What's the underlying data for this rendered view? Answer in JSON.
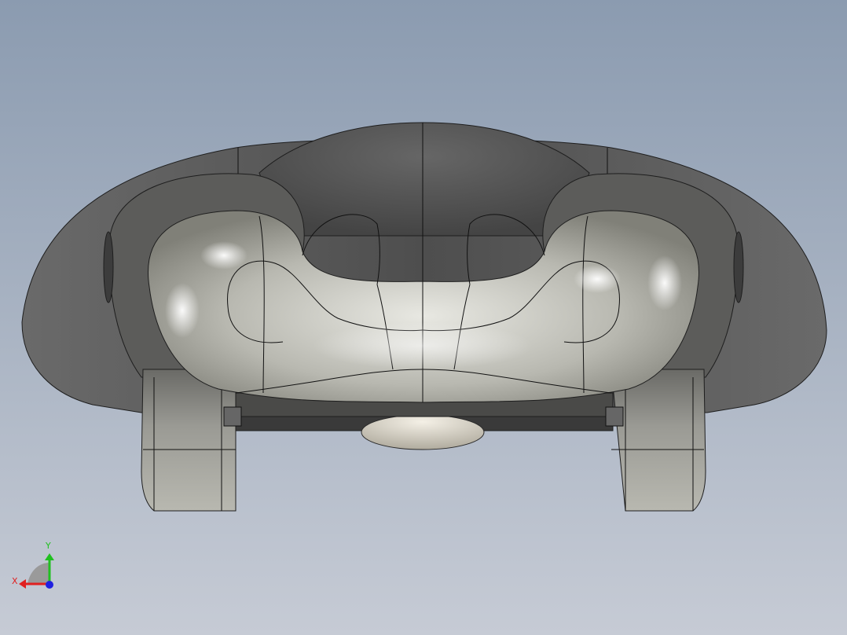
{
  "viewport": {
    "background_top": "#8b9bb0",
    "background_bottom": "#c6cbd5"
  },
  "model": {
    "shell_color": "#5a5a5a",
    "shell_edge_color": "#1a1a1a",
    "seat_color": "#c8c8c2",
    "seat_highlight": "#f7f7f1"
  },
  "triad": {
    "x_label": "X",
    "y_label": "Y",
    "x_color": "#e02020",
    "y_color": "#20c020",
    "z_color": "#2020e0"
  }
}
